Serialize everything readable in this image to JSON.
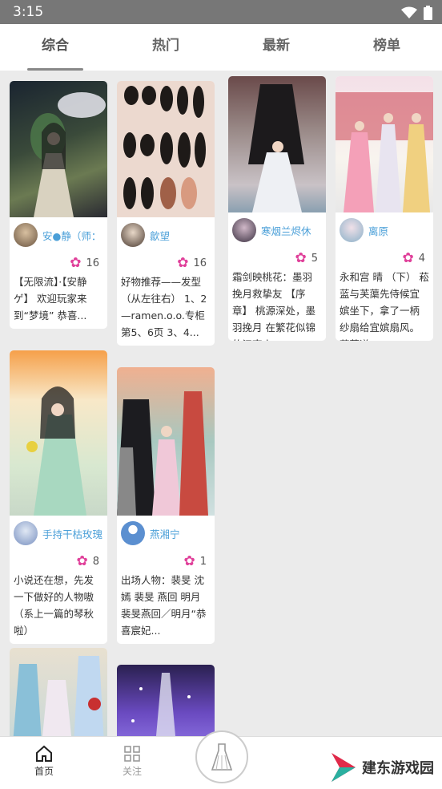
{
  "status": {
    "time": "3:15"
  },
  "tabs": [
    {
      "label": "综合"
    },
    {
      "label": "热门"
    },
    {
      "label": "最新"
    },
    {
      "label": "榜单"
    }
  ],
  "posts": [
    {
      "author": "安●静（师：",
      "likes": "16",
      "desc": "【无限流】·【安静ゲ】 欢迎玩家来到“梦境” 恭喜..."
    },
    {
      "author": "歙望",
      "likes": "16",
      "desc": "好物推荐——发型（从左往右） 1、2—ramen.o.o.专柜第5、6页 3、4..."
    },
    {
      "author": "寒烟兰烬休",
      "likes": "5",
      "desc": "霜剑映桃花：墨羽挽月救挚友 【序章】 桃源深处，墨羽挽月 在繁花似锦的江南小..."
    },
    {
      "author": "离原",
      "likes": "4",
      "desc": "永和宫 晴 （下） 菘蓝与芙蕖先侍候宜嫔坐下，拿了一柄纱扇给宜嫔扇风。 菘蓝道：..."
    },
    {
      "author": "手持干枯玫瑰",
      "likes": "8",
      "desc": "小说还在想，先发一下做好的人物嗷（系上一篇的琴秋啦）"
    },
    {
      "author": "燕湘宁",
      "likes": "1",
      "desc": "出场人物：裴旻 沈嫣 裴旻 燕回 明月 裴旻燕回／明月“恭喜宸妃..."
    }
  ],
  "bottom_nav": {
    "home": "首页",
    "follow": "关注"
  },
  "watermark": "建东游戏园",
  "colors": {
    "accent_blue": "#4a9fd8",
    "flower_pink": "#e0409a"
  }
}
